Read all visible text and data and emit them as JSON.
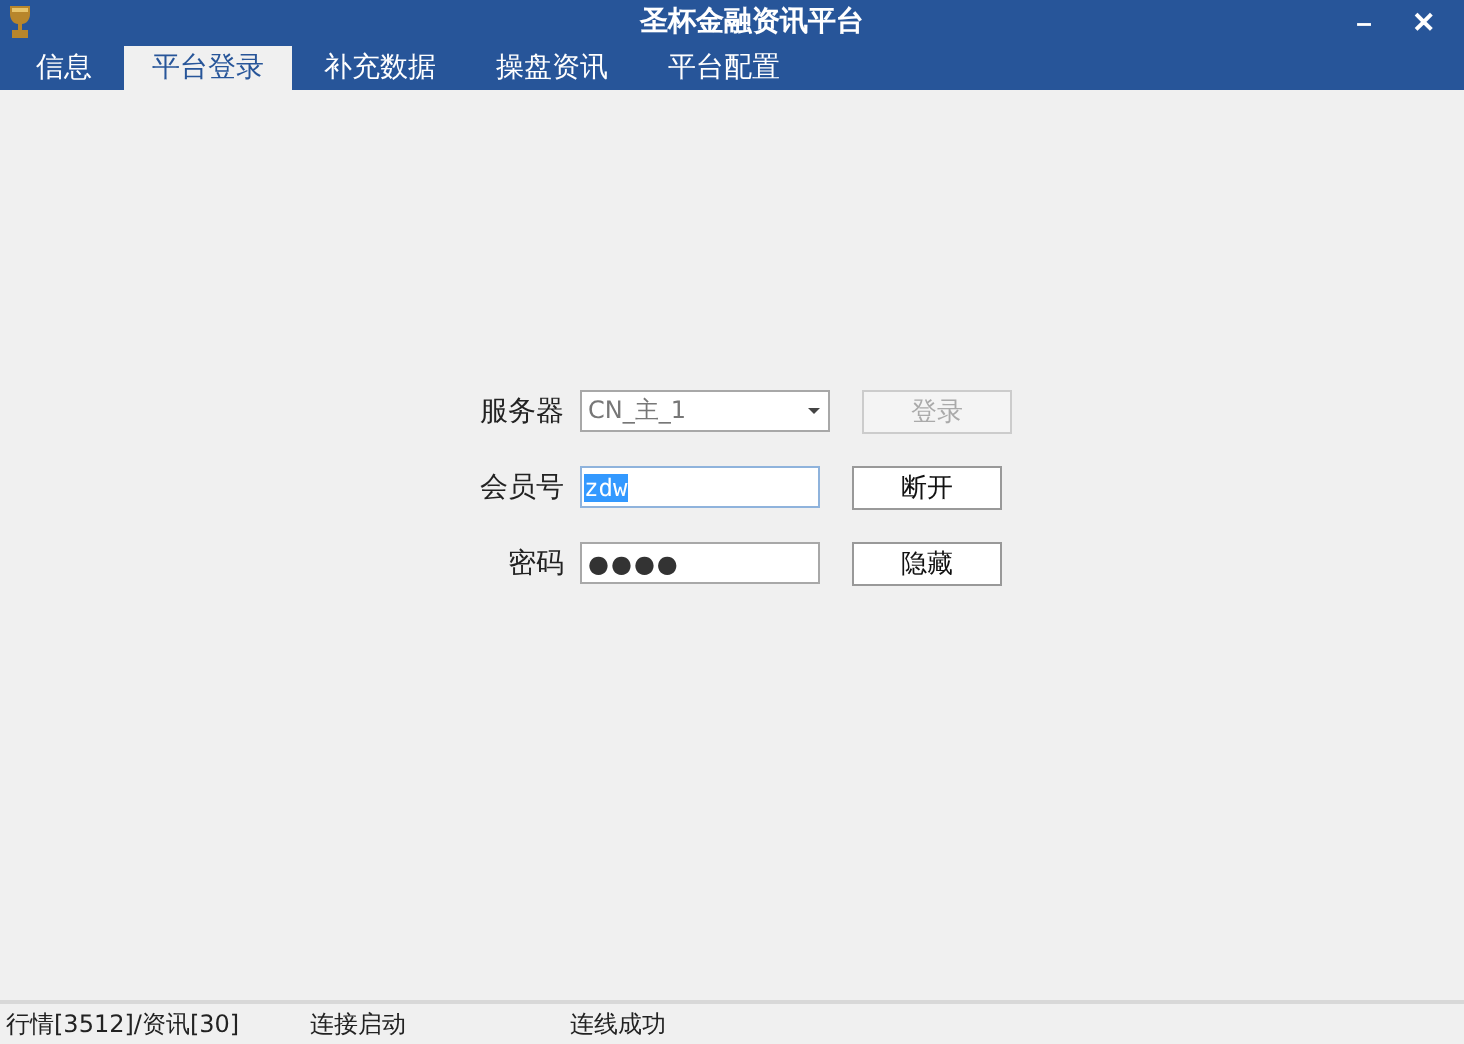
{
  "window": {
    "title": "圣杯金融资讯平台",
    "minimize": "–",
    "close": "✕"
  },
  "tabs": [
    {
      "label": "信息",
      "selected": false
    },
    {
      "label": "平台登录",
      "selected": true
    },
    {
      "label": "补充数据",
      "selected": false
    },
    {
      "label": "操盘资讯",
      "selected": false
    },
    {
      "label": "平台配置",
      "selected": false
    }
  ],
  "form": {
    "rows": [
      {
        "label": "服务器",
        "kind": "dropdown",
        "value": "CN_主_1",
        "button": {
          "label": "登录",
          "disabled": true
        }
      },
      {
        "label": "会员号",
        "kind": "text",
        "value": "zdw",
        "text_selected": true,
        "button": {
          "label": "断开",
          "disabled": false
        }
      },
      {
        "label": "密码",
        "kind": "password",
        "value": "●●●●",
        "button": {
          "label": "隐藏",
          "disabled": false
        }
      }
    ]
  },
  "status_bar": [
    "行情[3512]/资讯[30]",
    "连接启动",
    "连线成功"
  ]
}
